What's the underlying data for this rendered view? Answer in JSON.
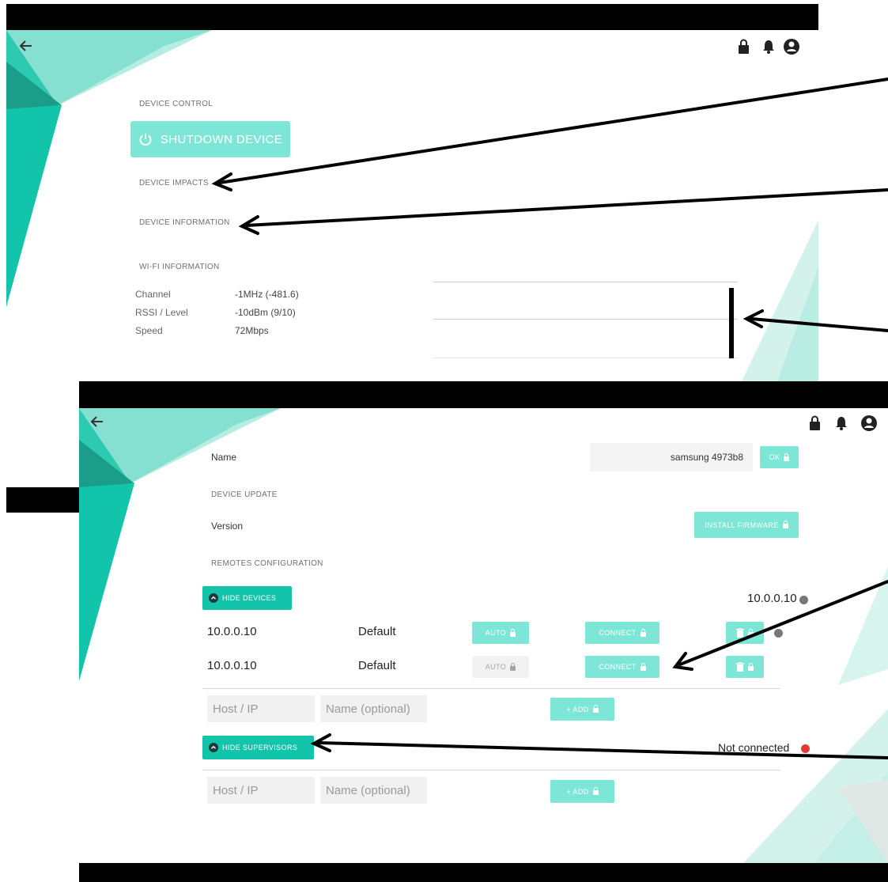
{
  "top": {
    "device_control_label": "DEVICE CONTROL",
    "shutdown_label": "SHUTDOWN DEVICE",
    "device_impacts_label": "DEVICE IMPACTS",
    "device_information_label": "DEVICE INFORMATION",
    "wifi_information_label": "WI-FI INFORMATION",
    "wifi_rows": [
      {
        "label": "Channel",
        "value": "-1MHz (-481.6)"
      },
      {
        "label": "RSSI / Level",
        "value": "-10dBm (9/10)"
      },
      {
        "label": "Speed",
        "value": "72Mbps"
      }
    ]
  },
  "bottom": {
    "name_label": "Name",
    "name_value": "samsung 4973b8",
    "ok_label": "OK",
    "device_update_label": "DEVICE UPDATE",
    "version_label": "Version",
    "install_firmware_label": "INSTALL FIRMWARE",
    "remotes_label": "REMOTES CONFIGURATION",
    "hide_devices_label": "HIDE DEVICES",
    "devices_status": "10.0.0.10",
    "devices": [
      {
        "ip": "10.0.0.10",
        "name": "Default",
        "auto": "AUTO",
        "connect": "CONNECT"
      },
      {
        "ip": "10.0.0.10",
        "name": "Default",
        "auto": "AUTO",
        "connect": "CONNECT"
      }
    ],
    "host_placeholder": "Host / IP",
    "name_placeholder": "Name (optional)",
    "add_label": "+ ADD",
    "hide_supervisors_label": "HIDE SUPERVISORS",
    "supervisors_status": "Not connected"
  },
  "icons": [
    "back-arrow-icon",
    "lock-icon",
    "bell-icon",
    "account-icon",
    "power-icon",
    "trash-icon",
    "chevron-up-icon"
  ],
  "colors": {
    "accent": "#12c4a9",
    "accent_light": "#7ee6d6",
    "teal_dark": "#1a9e8a",
    "error": "#e53935"
  }
}
